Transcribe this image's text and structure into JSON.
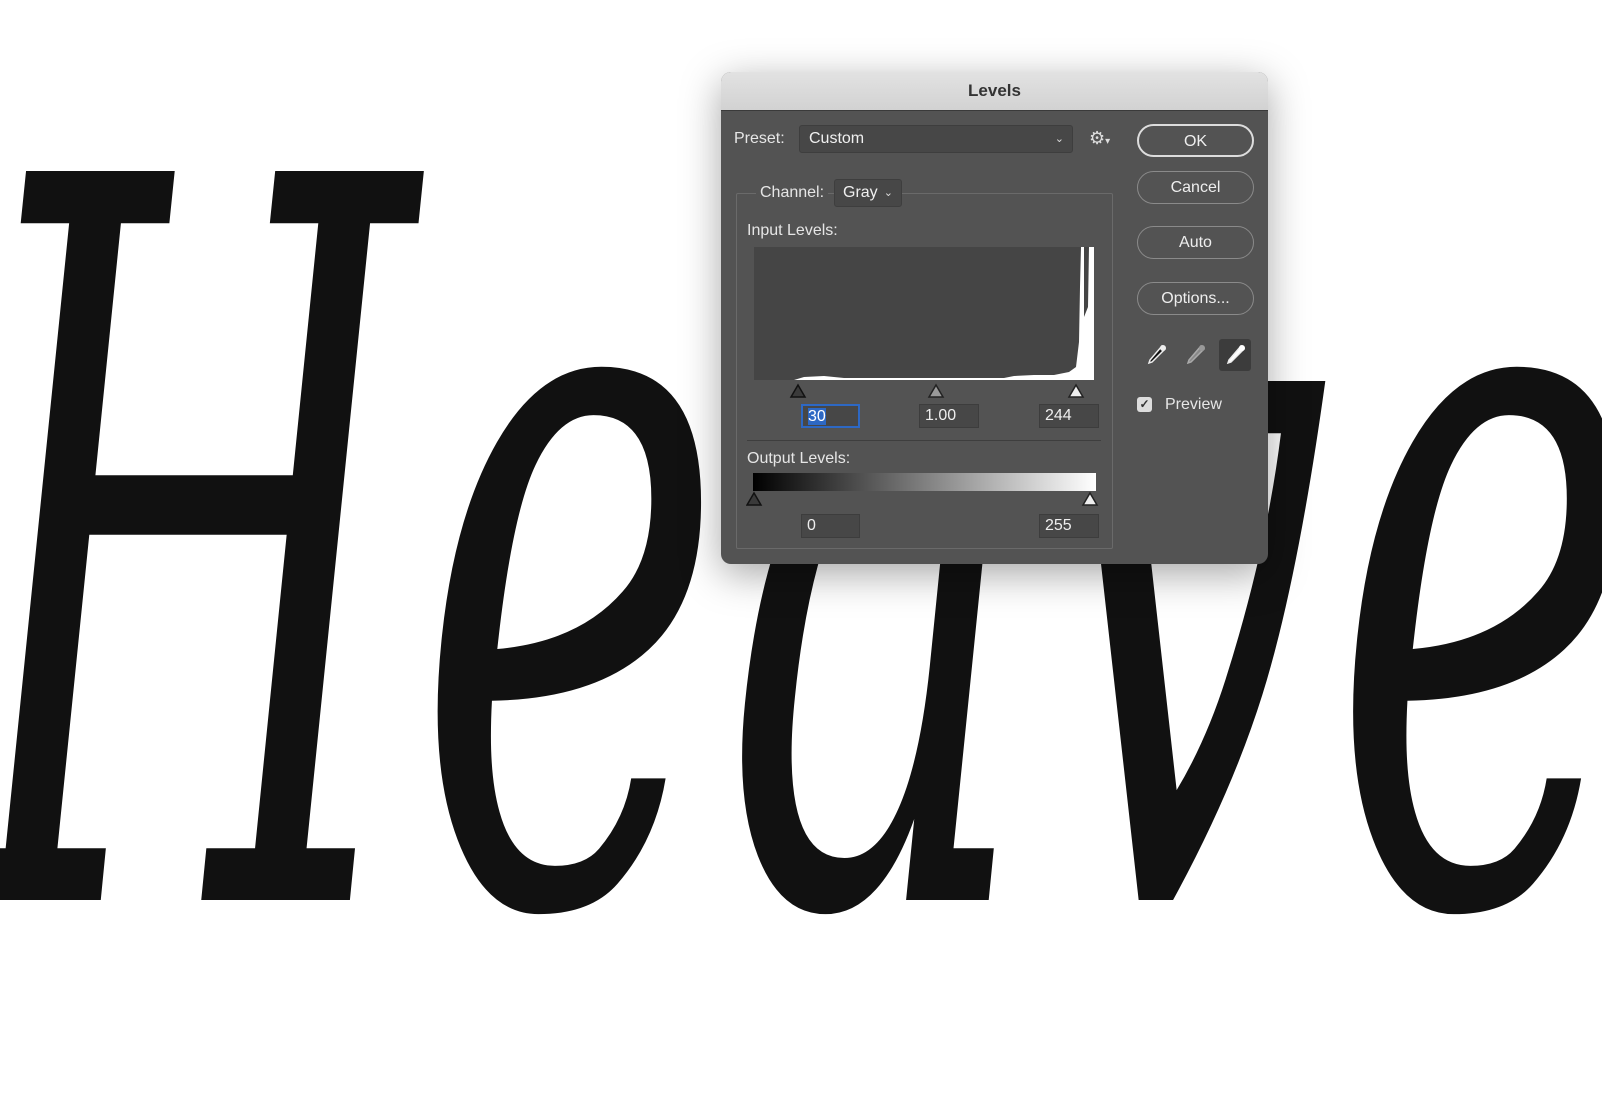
{
  "background": {
    "lettering": "Heave"
  },
  "dialog": {
    "title": "Levels",
    "preset": {
      "label": "Preset:",
      "value": "Custom"
    },
    "channel": {
      "label": "Channel:",
      "value": "Gray"
    },
    "input_levels": {
      "label": "Input Levels:",
      "black": "30",
      "gamma": "1.00",
      "white": "244"
    },
    "output_levels": {
      "label": "Output Levels:",
      "black": "0",
      "white": "255"
    },
    "buttons": {
      "ok": "OK",
      "cancel": "Cancel",
      "auto": "Auto",
      "options": "Options..."
    },
    "preview": {
      "label": "Preview",
      "checked": true
    },
    "icons": {
      "gear": "gear-icon",
      "eyedroppers": [
        "black-point-eyedropper-icon",
        "gray-point-eyedropper-icon",
        "white-point-eyedropper-icon"
      ]
    },
    "colors": {
      "focus": "#2d68c4",
      "panel": "#535353"
    }
  }
}
